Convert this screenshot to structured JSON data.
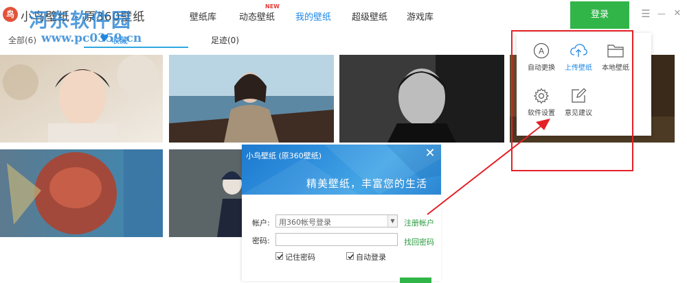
{
  "app": {
    "title": "小鸟壁纸 - 原360壁纸",
    "logo_glyph": "鸟",
    "watermark_line1": "河东软件园",
    "watermark_line2": "www.pc0359.cn"
  },
  "nav": {
    "items": [
      {
        "label": "壁纸库"
      },
      {
        "label": "动态壁纸",
        "badge": "NEW"
      },
      {
        "label": "我的壁纸",
        "active": true
      },
      {
        "label": "超级壁纸"
      },
      {
        "label": "游戏库"
      }
    ],
    "login_label": "登录"
  },
  "window_controls": {
    "menu": "☰",
    "minimize": "—",
    "close": "✕"
  },
  "subtabs": {
    "all": "全部(6)",
    "favorites": "收藏",
    "history": "足迹(0)"
  },
  "menu": {
    "items": [
      {
        "label": "自动更换",
        "icon": "letter-a-circle-icon"
      },
      {
        "label": "上传壁纸",
        "icon": "cloud-upload-icon",
        "active": true
      },
      {
        "label": "本地壁纸",
        "icon": "folder-icon"
      },
      {
        "label": "软件设置",
        "icon": "gear-icon"
      },
      {
        "label": "意见建议",
        "icon": "edit-icon"
      }
    ]
  },
  "dialog": {
    "title": "小鸟壁纸 (原360壁纸)",
    "close": "✕",
    "slogan": "精美壁纸，丰富您的生活",
    "account_label": "帐户:",
    "account_value": "用360帐号登录",
    "password_label": "密码:",
    "register_link": "注册帐户",
    "forgot_link": "找回密码",
    "remember_label": "记住密码",
    "remember_checked": true,
    "autologin_label": "自动登录",
    "autologin_checked": true
  },
  "colors": {
    "accent": "#1e88e5",
    "login_green": "#31b548",
    "annotation_red": "#e32026",
    "link_green": "#2a9b3f"
  }
}
